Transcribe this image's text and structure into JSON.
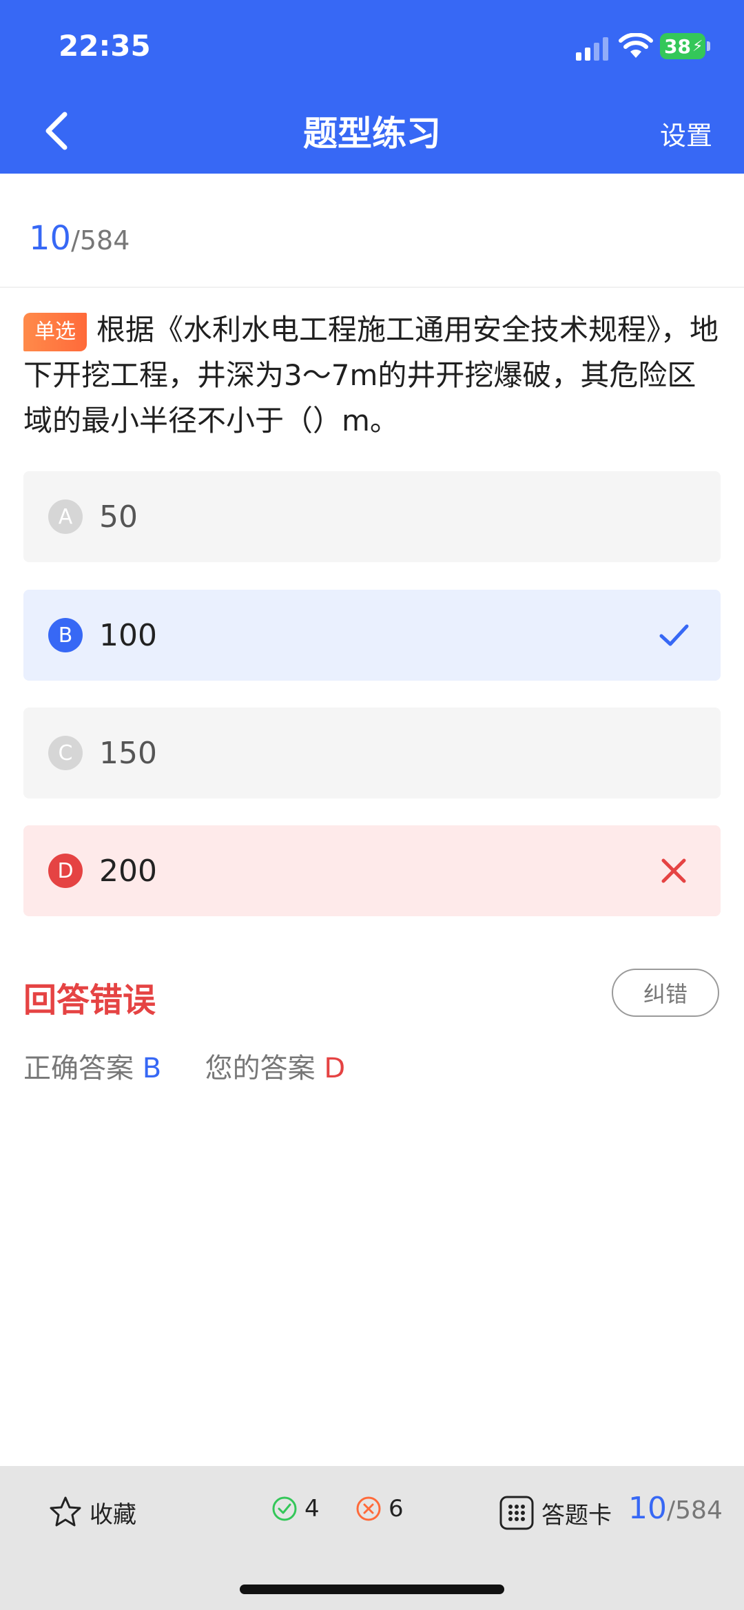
{
  "status_bar": {
    "time": "22:35",
    "battery": "38"
  },
  "header": {
    "title": "题型练习",
    "settings_label": "设置"
  },
  "progress": {
    "current": "10",
    "total": "/584"
  },
  "question": {
    "type_label": "单选",
    "text": "根据《水利水电工程施工通用安全技术规程》，地下开挖工程，井深为3～7m的井开挖爆破，其危险区域的最小半径不小于（）m。"
  },
  "options": [
    {
      "letter": "A",
      "text": "50"
    },
    {
      "letter": "B",
      "text": "100"
    },
    {
      "letter": "C",
      "text": "150"
    },
    {
      "letter": "D",
      "text": "200"
    }
  ],
  "result": {
    "title": "回答错误",
    "report_label": "纠错",
    "correct_label": "正确答案",
    "correct_value": "B",
    "yours_label": "您的答案",
    "yours_value": "D"
  },
  "bottom_bar": {
    "favorite_label": "收藏",
    "correct_count": "4",
    "wrong_count": "6",
    "card_label": "答题卡",
    "progress_current": "10",
    "progress_total": "/584"
  },
  "colors": {
    "primary": "#3768f5",
    "error": "#e54343",
    "success": "#34c759",
    "tag_orange": "#ff7a3f"
  }
}
